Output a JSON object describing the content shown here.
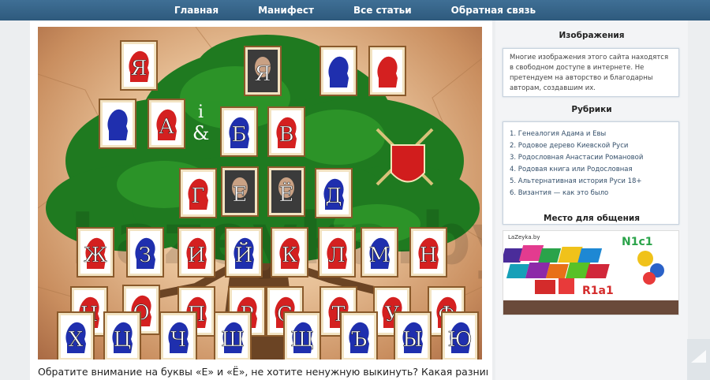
{
  "nav": {
    "items": [
      "Главная",
      "Манифест",
      "Все статьи",
      "Обратная связь"
    ]
  },
  "tree": {
    "watermark": "Lazeyka.by",
    "ampersand": "i\n&",
    "cards": [
      {
        "letter": "Я",
        "color": "red"
      },
      {
        "letter": "Я",
        "color": "photo"
      },
      {
        "letter": "",
        "color": "blue"
      },
      {
        "letter": "",
        "color": "red"
      },
      {
        "letter": "",
        "color": "blue"
      },
      {
        "letter": "А",
        "color": "red"
      },
      {
        "letter": "Б",
        "color": "blue"
      },
      {
        "letter": "В",
        "color": "red"
      },
      {
        "letter": "Г",
        "color": "red"
      },
      {
        "letter": "Е",
        "color": "photo"
      },
      {
        "letter": "Ё",
        "color": "photo"
      },
      {
        "letter": "Д",
        "color": "blue"
      },
      {
        "letter": "Ж",
        "color": "red"
      },
      {
        "letter": "З",
        "color": "blue"
      },
      {
        "letter": "И",
        "color": "red"
      },
      {
        "letter": "Й",
        "color": "blue"
      },
      {
        "letter": "К",
        "color": "red"
      },
      {
        "letter": "Л",
        "color": "red"
      },
      {
        "letter": "М",
        "color": "blue"
      },
      {
        "letter": "Н",
        "color": "red"
      },
      {
        "letter": "Н",
        "color": "red"
      },
      {
        "letter": "О",
        "color": "red"
      },
      {
        "letter": "П",
        "color": "red"
      },
      {
        "letter": "Р",
        "color": "red"
      },
      {
        "letter": "С",
        "color": "red"
      },
      {
        "letter": "Т",
        "color": "red"
      },
      {
        "letter": "У",
        "color": "red"
      },
      {
        "letter": "Ф",
        "color": "red"
      },
      {
        "letter": "Х",
        "color": "blue"
      },
      {
        "letter": "Ц",
        "color": "blue"
      },
      {
        "letter": "Ч",
        "color": "blue"
      },
      {
        "letter": "Ш",
        "color": "blue"
      },
      {
        "letter": "Щ",
        "color": "blue"
      },
      {
        "letter": "Ъ",
        "color": "blue"
      },
      {
        "letter": "Ы",
        "color": "blue"
      },
      {
        "letter": "Ю",
        "color": "blue"
      }
    ]
  },
  "caption": "Обратите внимание на буквы «Е» и «Ё», не хотите ненужную выкинуть? Какая разница",
  "sidebar": {
    "images_title": "Изображения",
    "images_text": "Многие изображения этого сайта находятся в свободном доступе в интернете. Не претендуем на авторство и благодарны авторам, создавшим их.",
    "rubrics_title": "Рубрики",
    "rubrics": [
      "1. Генеалогия Адама и Евы",
      "2. Родовое дерево Киевской Руси",
      "3. Родословная Анастасии Романовой",
      "4. Родовая книга или Родословная",
      "5. Альтернативная история Руси 18+",
      "6. Византия — как это было"
    ],
    "chat_title": "Место для общения",
    "ad": {
      "brand": "LaZeyka.by",
      "tag1": "N1c1",
      "tag2": "R1a1"
    }
  },
  "colors": {
    "nav": "#33628a",
    "red": "#d42020",
    "blue": "#1f2fae",
    "tree": "#1f7a20"
  }
}
